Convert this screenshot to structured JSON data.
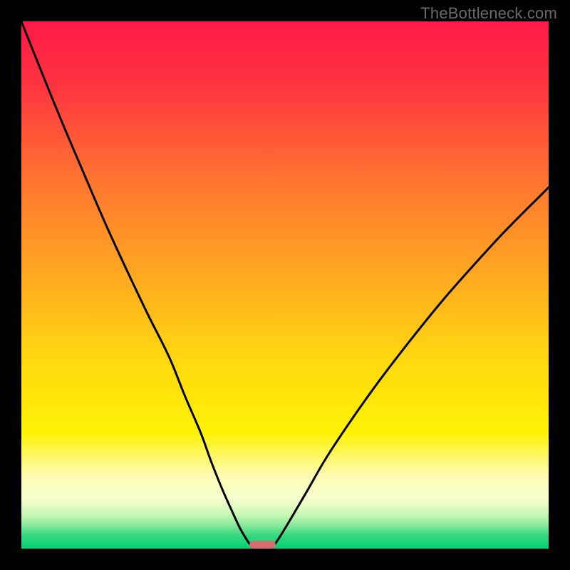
{
  "watermark": "TheBottleneck.com",
  "chart_data": {
    "type": "line",
    "title": "",
    "xlabel": "",
    "ylabel": "",
    "xlim": [
      0,
      100
    ],
    "ylim": [
      0,
      100
    ],
    "legend": false,
    "grid": false,
    "background_gradient": {
      "direction": "vertical",
      "stops": [
        {
          "pos": 0.0,
          "color": "#ff1a46"
        },
        {
          "pos": 0.12,
          "color": "#ff3340"
        },
        {
          "pos": 0.3,
          "color": "#ff7430"
        },
        {
          "pos": 0.48,
          "color": "#ffa820"
        },
        {
          "pos": 0.64,
          "color": "#ffd810"
        },
        {
          "pos": 0.78,
          "color": "#fff205"
        },
        {
          "pos": 0.86,
          "color": "#fffbb0"
        },
        {
          "pos": 0.905,
          "color": "#f6ffd0"
        },
        {
          "pos": 0.935,
          "color": "#c8f8b5"
        },
        {
          "pos": 0.955,
          "color": "#8ae99d"
        },
        {
          "pos": 0.975,
          "color": "#36d97f"
        },
        {
          "pos": 1.0,
          "color": "#00cf74"
        }
      ]
    },
    "series": [
      {
        "name": "left-branch",
        "x": [
          0,
          4,
          8,
          12,
          16,
          20,
          24,
          28,
          31,
          34,
          36,
          38,
          40,
          41.5,
          43,
          44
        ],
        "y": [
          100,
          90.0,
          80.2,
          70.8,
          61.5,
          52.8,
          44.4,
          36.4,
          29.0,
          22.0,
          16.5,
          11.5,
          7.0,
          3.8,
          1.3,
          0.0
        ]
      },
      {
        "name": "right-branch",
        "x": [
          47.5,
          49,
          51,
          54,
          58,
          63,
          68,
          74,
          80,
          86,
          92,
          100
        ],
        "y": [
          0.0,
          2.2,
          5.5,
          10.6,
          17.5,
          25.0,
          32.0,
          39.8,
          47.2,
          54.0,
          60.5,
          68.5
        ]
      }
    ],
    "marker": {
      "name": "minimum-indicator",
      "x_start": 43.2,
      "x_end": 48.2,
      "y": 0.7,
      "color": "#d66e6e",
      "height_pct": 1.5
    }
  }
}
